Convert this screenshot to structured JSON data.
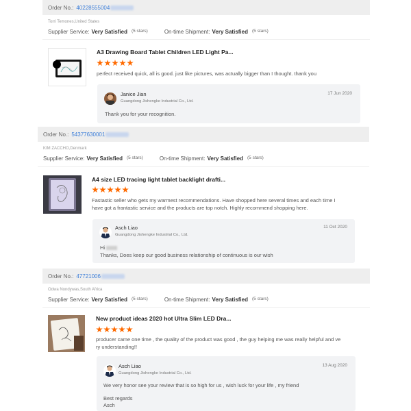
{
  "labels": {
    "order_no": "Order No.:",
    "supplier_service": "Supplier Service:",
    "ontime_shipment": "On-time Shipment:"
  },
  "orders": [
    {
      "order_number": "40228555004",
      "buyer": "Torri Temones,United States",
      "supplier_service": "Very Satisfied",
      "supplier_stars": "(5 stars)",
      "ontime_shipment": "Very Satisfied",
      "ontime_stars": "(5 stars)",
      "product_title": "A3 Drawing Board Tablet Children LED Light Pa...",
      "rating": 5,
      "review": "perfect received quick, all is good.  just like pictures, was actually bigger than I thought. thank you",
      "reply": {
        "name": "Janice Jian",
        "company": "Guangdong Jishengke Industrial Co., Ltd.",
        "date": "17 Jun 2020",
        "text": "Thank you for your recognition."
      }
    },
    {
      "order_number": "54377630001",
      "buyer": "KIM ZACCHO,Denmark",
      "supplier_service": "Very Satisfied",
      "supplier_stars": "(5 stars)",
      "ontime_shipment": "Very Satisfied",
      "ontime_stars": "(5 stars)",
      "product_title": "A4 size LED tracing light tablet backlight drafti...",
      "rating": 5,
      "review_line1": "Fastastic seller who gets my warmest recommendations. Have shopped here several times and each time I",
      "review_line2": "have got a frantastic service and the products are top notch. Highly recommend shopping here.",
      "reply": {
        "name": "Asch Liao",
        "company": "Guangdong Jishengke Industrial Co., Ltd.",
        "date": "11 Oct 2020",
        "greeting": "Hi",
        "text": "Thanks, Does keep our good business relationship of continuous is our wish"
      }
    },
    {
      "order_number": "47721006",
      "buyer": "Odwa Nondywas,South Africa",
      "supplier_service": "Very Satisfied",
      "supplier_stars": "(5 stars)",
      "ontime_shipment": "Very Satisfied",
      "ontime_stars": "(5 stars)",
      "product_title": "New product ideas 2020 hot Ultra Slim LED Dra...",
      "rating": 5,
      "review_line1": "producer came one time , the quality of the product was good , the guy helping me was really helpful and ve",
      "review_line2": "ry understanding!!",
      "reply": {
        "name": "Asch Liao",
        "company": "Guangdong Jishengke Industrial Co., Ltd.",
        "date": "13 Aug 2020",
        "text": "We very honor see your review  that is so high for us , wish luck for your life , my friend",
        "closing1": "Best regards",
        "closing2": "Asch"
      }
    }
  ],
  "colors": {
    "accent_link": "#3b7dd8",
    "star": "#ff6a00",
    "order_bar": "#eeeeee",
    "reply_bg": "#f2f3f5"
  }
}
